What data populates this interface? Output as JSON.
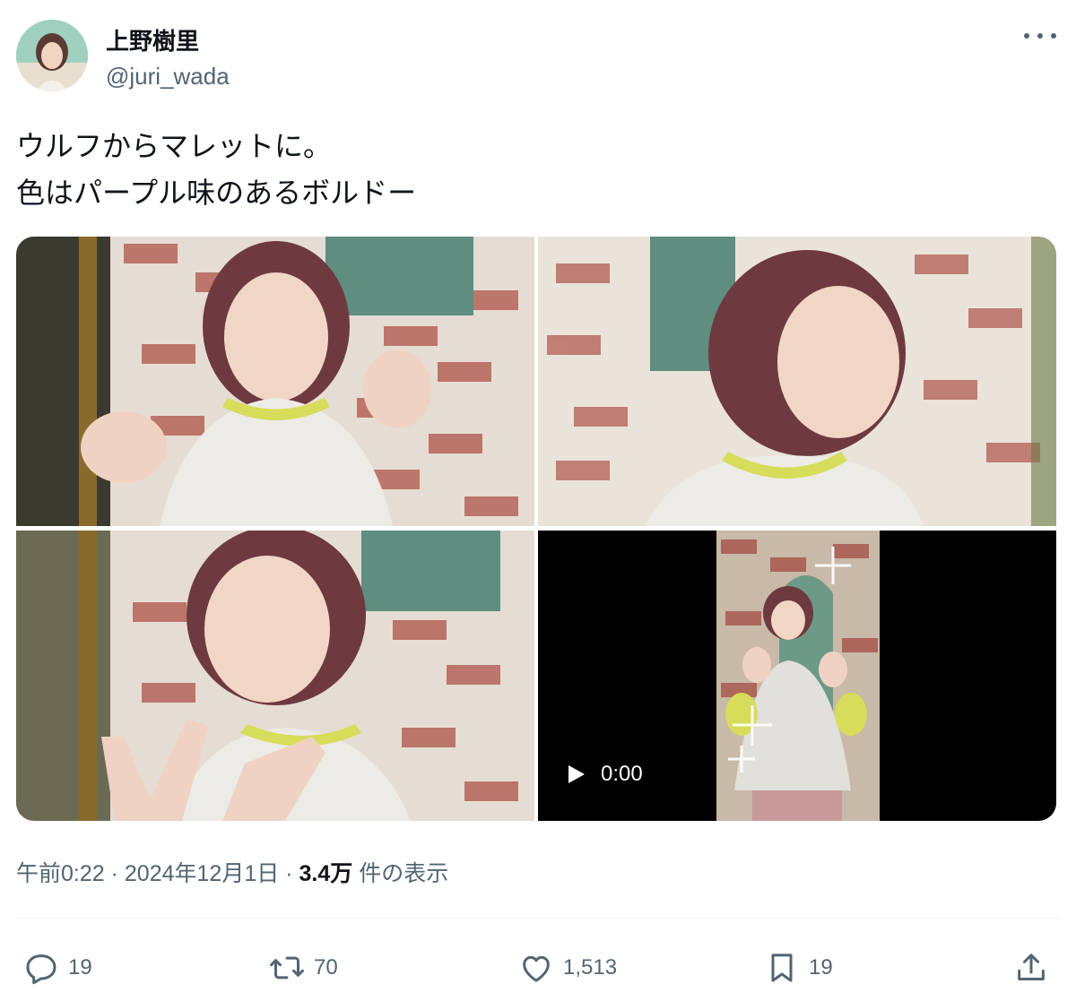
{
  "author": {
    "display_name": "上野樹里",
    "handle": "@juri_wada"
  },
  "post": {
    "text_line1": "ウルフからマレットに。",
    "text_line2": "色はパープル味のあるボルドー"
  },
  "media": {
    "video_duration": "0:00"
  },
  "meta": {
    "time": "午前0:22",
    "sep1": "·",
    "date": "2024年12月1日",
    "sep2": "·",
    "views_count": "3.4万",
    "views_label": "件の表示"
  },
  "actions": {
    "replies": "19",
    "reposts": "70",
    "likes": "1,513",
    "bookmarks": "19"
  },
  "icons": [
    "more-icon",
    "reply-icon",
    "repost-icon",
    "like-icon",
    "bookmark-icon",
    "share-icon",
    "play-icon"
  ],
  "colors": {
    "text": "#0f1419",
    "secondary": "#536471",
    "hair": "#6e3a3f",
    "sweater": "#ecebe6",
    "collar": "#d7dc5a",
    "panel": "#5f8d80"
  }
}
